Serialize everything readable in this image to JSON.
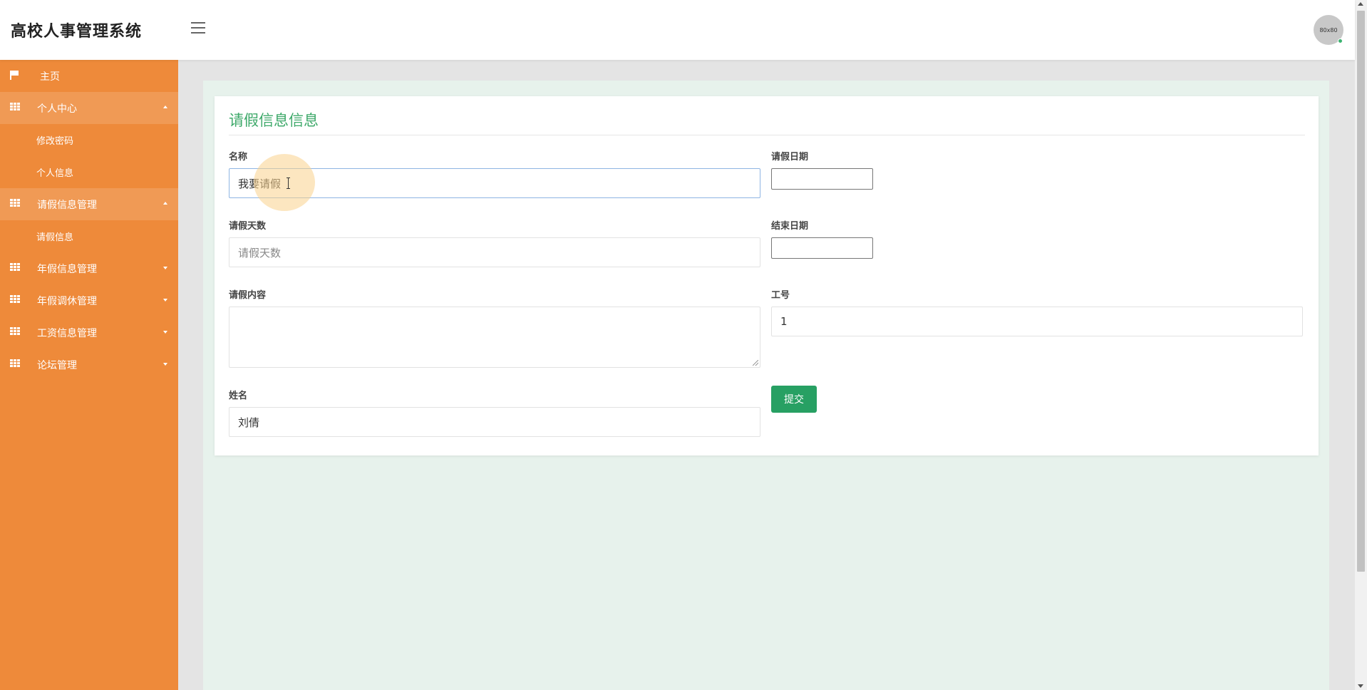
{
  "header": {
    "title": "高校人事管理系统",
    "avatar_text": "80x80"
  },
  "sidebar": {
    "home": "主页",
    "personal_center": {
      "label": "个人中心",
      "items": [
        "修改密码",
        "个人信息"
      ]
    },
    "leave_mgmt": {
      "label": "请假信息管理",
      "items": [
        "请假信息"
      ]
    },
    "annual_leave": "年假信息管理",
    "leave_adjust": "年假调休管理",
    "salary": "工资信息管理",
    "forum": "论坛管理"
  },
  "form": {
    "title": "请假信息信息",
    "name_label": "名称",
    "name_value": "我要请假",
    "leave_date_label": "请假日期",
    "days_label": "请假天数",
    "days_placeholder": "请假天数",
    "end_date_label": "结束日期",
    "content_label": "请假内容",
    "emp_no_label": "工号",
    "emp_no_value": "1",
    "person_name_label": "姓名",
    "person_name_value": "刘倩",
    "submit_label": "提交"
  },
  "colors": {
    "sidebar": "#ee8a3a",
    "sidebar_open": "#f09a55",
    "accent": "#3ea96a",
    "submit": "#27a063",
    "main_bg": "#e7f2ec"
  }
}
